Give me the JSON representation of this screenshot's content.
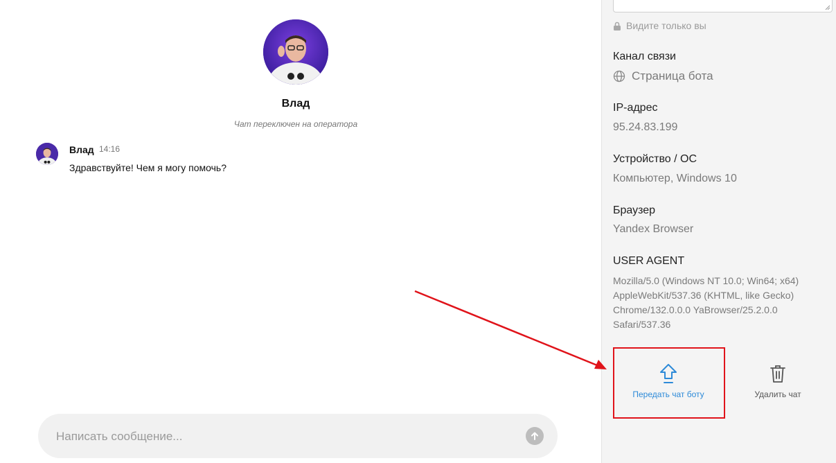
{
  "chat": {
    "contact_name": "Влад",
    "system_message": "Чат переключен на оператора",
    "messages": [
      {
        "author": "Влад",
        "time": "14:16",
        "text": "Здравствуйте! Чем я могу помочь?"
      }
    ],
    "composer_placeholder": "Написать сообщение...",
    "send_icon": "arrow-up-circle-icon"
  },
  "panel": {
    "private_note": "Видите только вы",
    "channel_label": "Канал связи",
    "channel_value": "Страница бота",
    "ip_label": "IP-адрес",
    "ip_value": "95.24.83.199",
    "device_label": "Устройство / ОС",
    "device_value": "Компьютер, Windows 10",
    "browser_label": "Браузер",
    "browser_value": "Yandex Browser",
    "ua_label": "USER AGENT",
    "ua_lines": [
      "Mozilla/5.0 (Windows NT 10.0; Win64; x64)",
      "AppleWebKit/537.36 (KHTML, like Gecko)",
      "Chrome/132.0.0.0 YaBrowser/25.2.0.0",
      "Safari/537.36"
    ],
    "actions": {
      "transfer_label": "Передать чат боту",
      "delete_label": "Удалить чат"
    }
  },
  "colors": {
    "accent": "#2d8ad8",
    "annotation": "#e0131a",
    "panel_bg": "#f4f4f4"
  }
}
